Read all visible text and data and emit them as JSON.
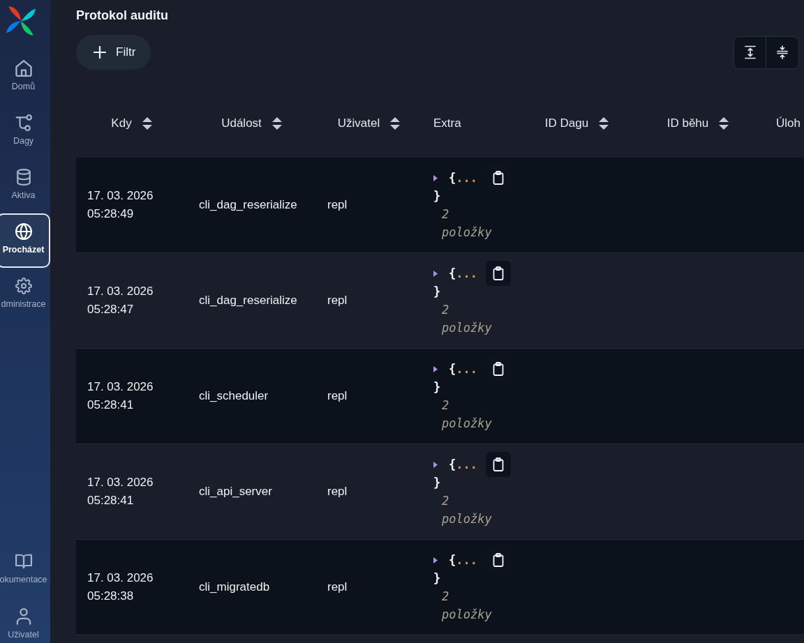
{
  "sidebar": {
    "items": [
      {
        "kind": "home",
        "label": "Domů",
        "selected": false
      },
      {
        "kind": "dags",
        "label": "Dagy",
        "selected": false
      },
      {
        "kind": "assets",
        "label": "Aktiva",
        "selected": false
      },
      {
        "kind": "browse",
        "label": "Procházet",
        "selected": true
      },
      {
        "kind": "admin",
        "label": "dministrace",
        "selected": false
      }
    ],
    "bottom_items": [
      {
        "kind": "docs",
        "label": "okumentace",
        "selected": false
      },
      {
        "kind": "user",
        "label": "Uživatel",
        "selected": false
      }
    ]
  },
  "page": {
    "title": "Protokol auditu",
    "filter_button": "Filtr"
  },
  "table": {
    "columns": [
      {
        "label": "Kdy",
        "sortable": true
      },
      {
        "label": "Událost",
        "sortable": true
      },
      {
        "label": "Uživatel",
        "sortable": true
      },
      {
        "label": "Extra",
        "sortable": false
      },
      {
        "label": "ID Dagu",
        "sortable": true
      },
      {
        "label": "ID běhu",
        "sortable": true
      },
      {
        "label": "Úloh",
        "sortable": false
      }
    ],
    "rows": [
      {
        "when": "17. 03. 2026 05:28:49",
        "event": "cli_dag_reserialize",
        "user": "repl",
        "extra": {
          "expanded": false,
          "open": "{",
          "ellipsis": "...",
          "close": "}",
          "count": "2 položky"
        }
      },
      {
        "when": "17. 03. 2026 05:28:47",
        "event": "cli_dag_reserialize",
        "user": "repl",
        "extra": {
          "expanded": false,
          "open": "{",
          "ellipsis": "...",
          "close": "}",
          "count": "2 položky"
        }
      },
      {
        "when": "17. 03. 2026 05:28:41",
        "event": "cli_scheduler",
        "user": "repl",
        "extra": {
          "expanded": false,
          "open": "{",
          "ellipsis": "...",
          "close": "}",
          "count": "2 položky"
        }
      },
      {
        "when": "17. 03. 2026 05:28:41",
        "event": "cli_api_server",
        "user": "repl",
        "extra": {
          "expanded": false,
          "open": "{",
          "ellipsis": "...",
          "close": "}",
          "count": "2 položky"
        }
      },
      {
        "when": "17. 03. 2026 05:28:38",
        "event": "cli_migratedb",
        "user": "repl",
        "extra": {
          "expanded": false,
          "open": "{",
          "ellipsis": "...",
          "close": "}",
          "count": "2 položky"
        }
      }
    ]
  }
}
